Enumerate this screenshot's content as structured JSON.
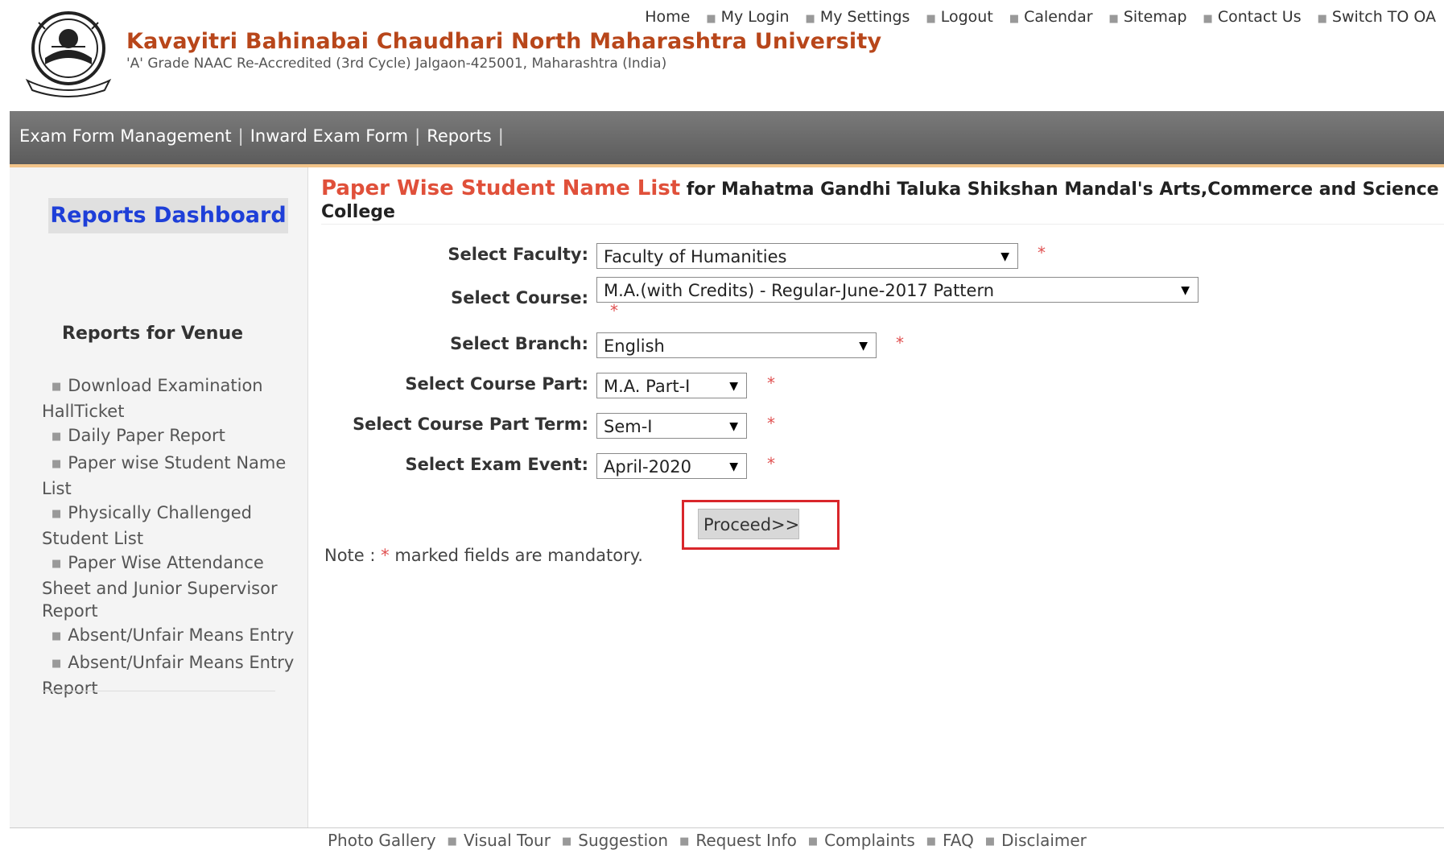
{
  "header": {
    "university_name": "Kavayitri Bahinabai Chaudhari North Maharashtra University",
    "subtitle": "'A' Grade NAAC Re-Accredited (3rd Cycle) Jalgaon-425001, Maharashtra (India)",
    "top_links": [
      "Home",
      "My Login",
      "My Settings",
      "Logout",
      "Calendar",
      "Sitemap",
      "Contact Us",
      "Switch TO OA"
    ]
  },
  "navbar": {
    "items": [
      "Exam Form Management",
      "Inward Exam Form",
      "Reports"
    ]
  },
  "sidebar": {
    "dashboard_label": "Reports Dashboard",
    "section_title": "Reports for Venue",
    "items": [
      "Download Examination HallTicket",
      "Daily Paper Report",
      "Paper wise Student Name List",
      "Physically Challenged Student List",
      "Paper Wise Attendance Sheet and Junior Supervisor Report",
      "Absent/Unfair Means Entry",
      "Absent/Unfair Means Entry Report"
    ]
  },
  "main": {
    "title_red": "Paper Wise Student Name List",
    "title_rest": " for Mahatma Gandhi Taluka Shikshan Mandal's Arts,Commerce and Science College",
    "form": {
      "faculty_label": "Select Faculty:",
      "faculty_value": "Faculty of Humanities",
      "course_label": "Select Course:",
      "course_value": "M.A.(with Credits) - Regular-June-2017 Pattern",
      "branch_label": "Select Branch:",
      "branch_value": "English",
      "course_part_label": "Select Course Part:",
      "course_part_value": "M.A. Part-I",
      "term_label": "Select Course Part Term:",
      "term_value": "Sem-I",
      "exam_event_label": "Select Exam Event:",
      "exam_event_value": "April-2020",
      "required_marker": "*"
    },
    "proceed_label": "Proceed>>",
    "note_prefix": "Note :",
    "note_star": "*",
    "note_text": "marked fields are mandatory."
  },
  "footer": {
    "links": [
      "Photo Gallery",
      "Visual Tour",
      "Suggestion",
      "Request Info",
      "Complaints",
      "FAQ",
      "Disclaimer"
    ]
  },
  "colors": {
    "brand": "#b8461a",
    "title_red": "#e0503a",
    "dashboard_blue": "#1e3fd8",
    "highlight_border": "#d9262b",
    "navbar_gray": "#666666",
    "required_red": "#e05050"
  }
}
